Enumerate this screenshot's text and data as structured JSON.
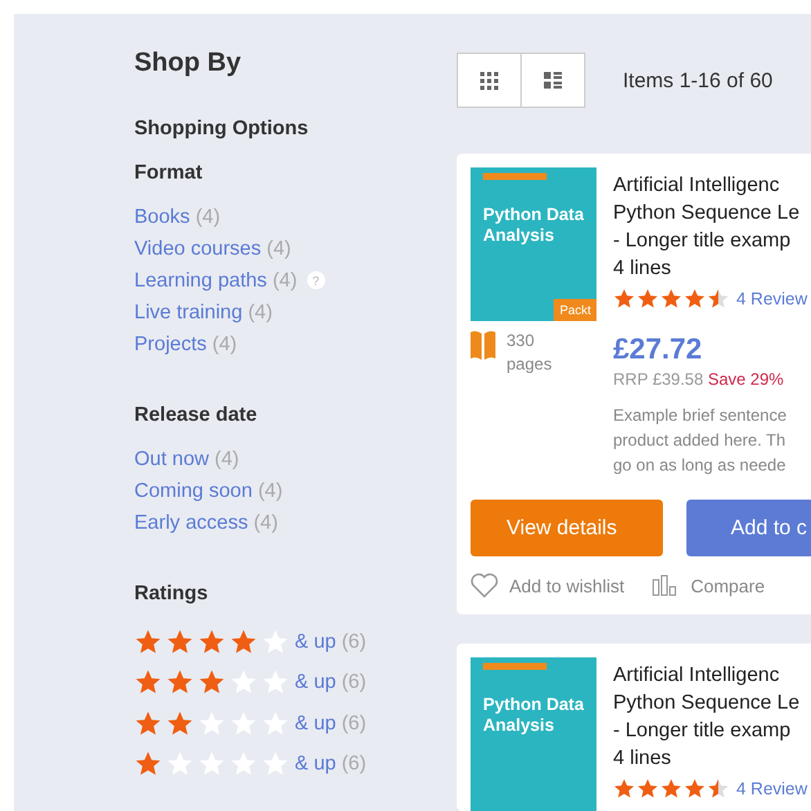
{
  "sidebar": {
    "title": "Shop By",
    "subtitle": "Shopping Options",
    "groups": [
      {
        "heading": "Format",
        "items": [
          {
            "label": "Books",
            "count": "(4)"
          },
          {
            "label": "Video courses",
            "count": "(4)"
          },
          {
            "label": "Learning paths",
            "count": "(4)",
            "help_icon": "?"
          },
          {
            "label": "Live training",
            "count": "(4)"
          },
          {
            "label": "Projects",
            "count": "(4)"
          }
        ]
      },
      {
        "heading": "Release date",
        "items": [
          {
            "label": "Out now",
            "count": "(4)"
          },
          {
            "label": "Coming soon",
            "count": "(4)"
          },
          {
            "label": "Early access",
            "count": "(4)"
          }
        ]
      }
    ],
    "ratings": {
      "heading": "Ratings",
      "rows": [
        {
          "stars": 4,
          "label": "& up",
          "count": "(6)"
        },
        {
          "stars": 3,
          "label": "& up",
          "count": "(6)"
        },
        {
          "stars": 2,
          "label": "& up",
          "count": "(6)"
        },
        {
          "stars": 1,
          "label": "& up",
          "count": "(6)"
        }
      ]
    }
  },
  "toolbar": {
    "views": [
      {
        "kind": "grid",
        "selected": false
      },
      {
        "kind": "list",
        "selected": false
      }
    ],
    "count": "Items 1-16 of 60"
  },
  "products": [
    {
      "cover": {
        "title": "Python Data Analysis",
        "publisher": "Packt"
      },
      "title_lines": [
        "Artificial Intelligenc",
        "Python Sequence Le",
        "- Longer title examp",
        "4 lines"
      ],
      "stars": 4.5,
      "reviews": "4 Review",
      "pages": "330",
      "pages_label": "pages",
      "price": "£27.72",
      "rrp": "RRP £39.58",
      "save": "Save 29%",
      "description_lines": [
        "Example brief sentence",
        "product added here. Th",
        "go on as long as neede"
      ],
      "buttons": [
        "View details",
        "Add to c"
      ],
      "wishlist": "Add to wishlist",
      "compare": "Compare"
    },
    {
      "cover": {
        "title": "Python Data Analysis"
      },
      "title_lines": [
        "Artificial Intelligenc",
        "Python Sequence Le",
        "- Longer title examp",
        "4 lines"
      ],
      "stars": 4.5,
      "reviews": "4 Review"
    }
  ]
}
